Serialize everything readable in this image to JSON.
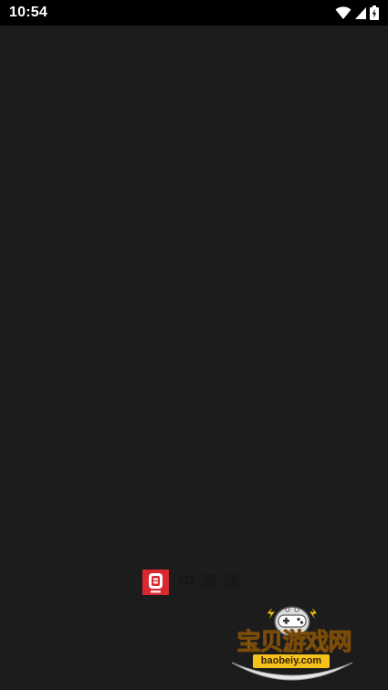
{
  "status_bar": {
    "time": "10:54",
    "icons": [
      "wifi-icon",
      "cellular-signal-icon",
      "battery-charging-icon"
    ]
  },
  "splash": {
    "app_name": "中海通",
    "logo_icon": "zhonghaitong-logo-icon",
    "logo_color": "#d9282f"
  },
  "watermark": {
    "title": "宝贝游戏网",
    "url": "baobeiy.com",
    "mascot_icon": "gamepad-mascot-icon"
  },
  "colors": {
    "background": "#1c1c1c",
    "status_bar": "#000000",
    "watermark_gold": "#f2b233"
  }
}
